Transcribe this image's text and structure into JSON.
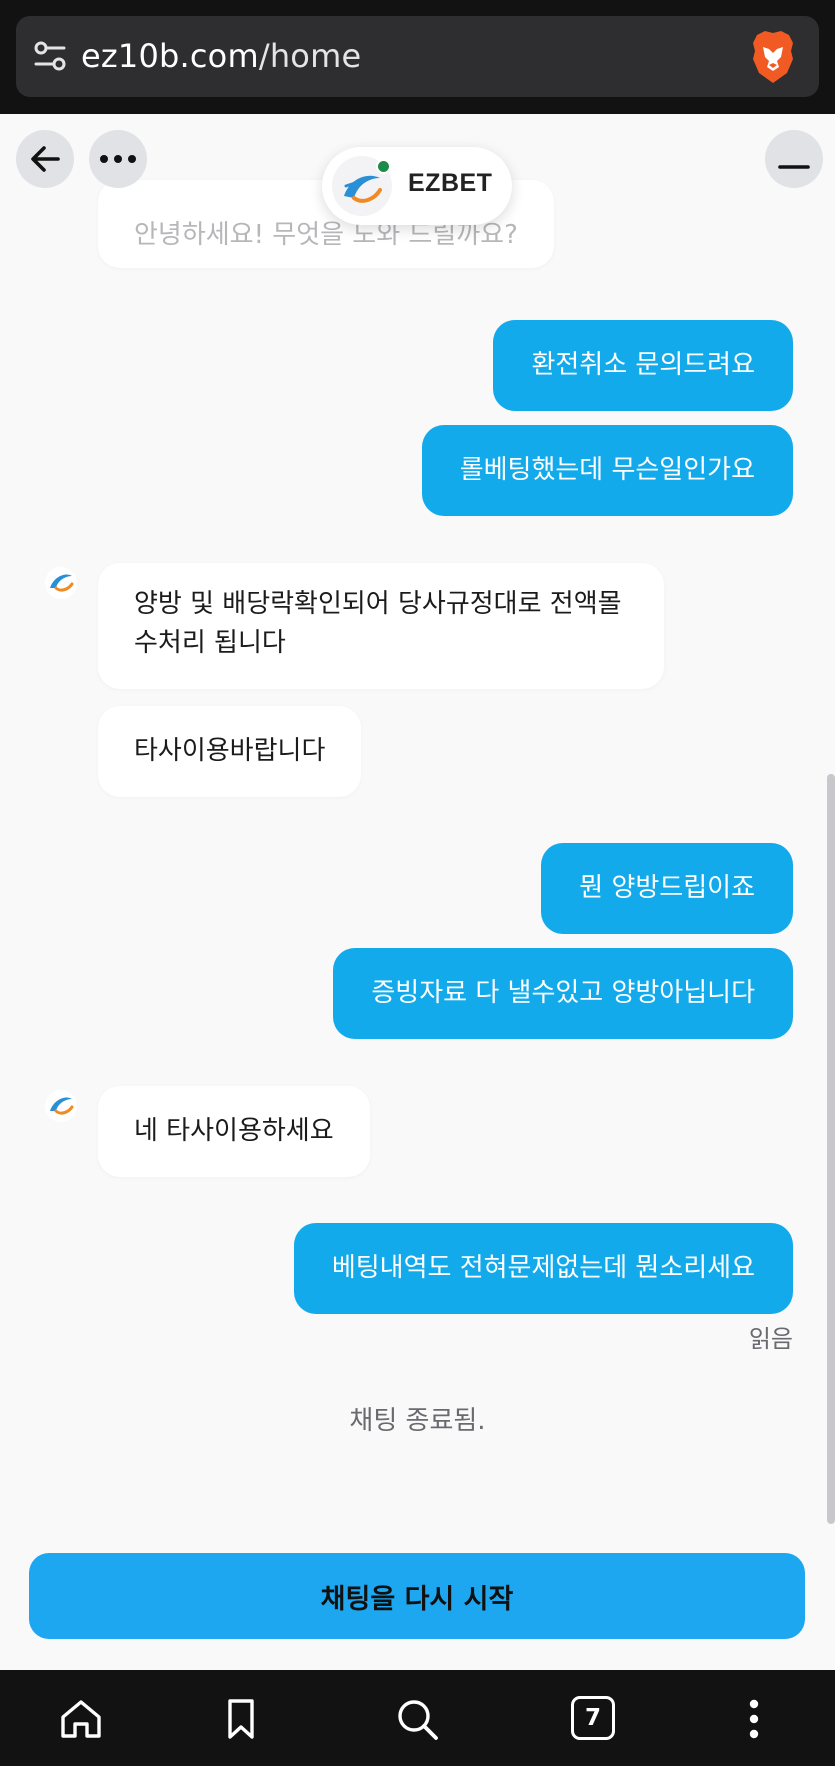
{
  "browser": {
    "url_host": "ez10b.com",
    "url_path": "/home",
    "tab_count": "7"
  },
  "header": {
    "brand_name": "EZBET"
  },
  "messages": [
    {
      "from": "agent",
      "text": "안녕하세요! 무엇을 도와 드릴까요?"
    },
    {
      "from": "user",
      "text": "환전취소 문의드려요"
    },
    {
      "from": "user",
      "text": "롤베팅했는데 무슨일인가요"
    },
    {
      "from": "agent",
      "line1": "양방 및 배당락확인되어 당사규정대로 전액몰",
      "line2": "수처리 됩니다"
    },
    {
      "from": "agent",
      "text": "타사이용바랍니다"
    },
    {
      "from": "user",
      "text": "뭔 양방드립이죠"
    },
    {
      "from": "user",
      "text": "증빙자료 다 낼수있고 양방아닙니다"
    },
    {
      "from": "agent",
      "text": "네 타사이용하세요"
    },
    {
      "from": "user",
      "text": "베팅내역도 전혀문제없는데 뭔소리세요"
    }
  ],
  "status": {
    "read": "읽음",
    "ended": "채팅 종료됨."
  },
  "restart_button": "채팅을 다시 시작",
  "colors": {
    "user_bubble": "#13aaeb",
    "restart_button": "#1da7f0",
    "online_dot": "#1e8a4a"
  }
}
